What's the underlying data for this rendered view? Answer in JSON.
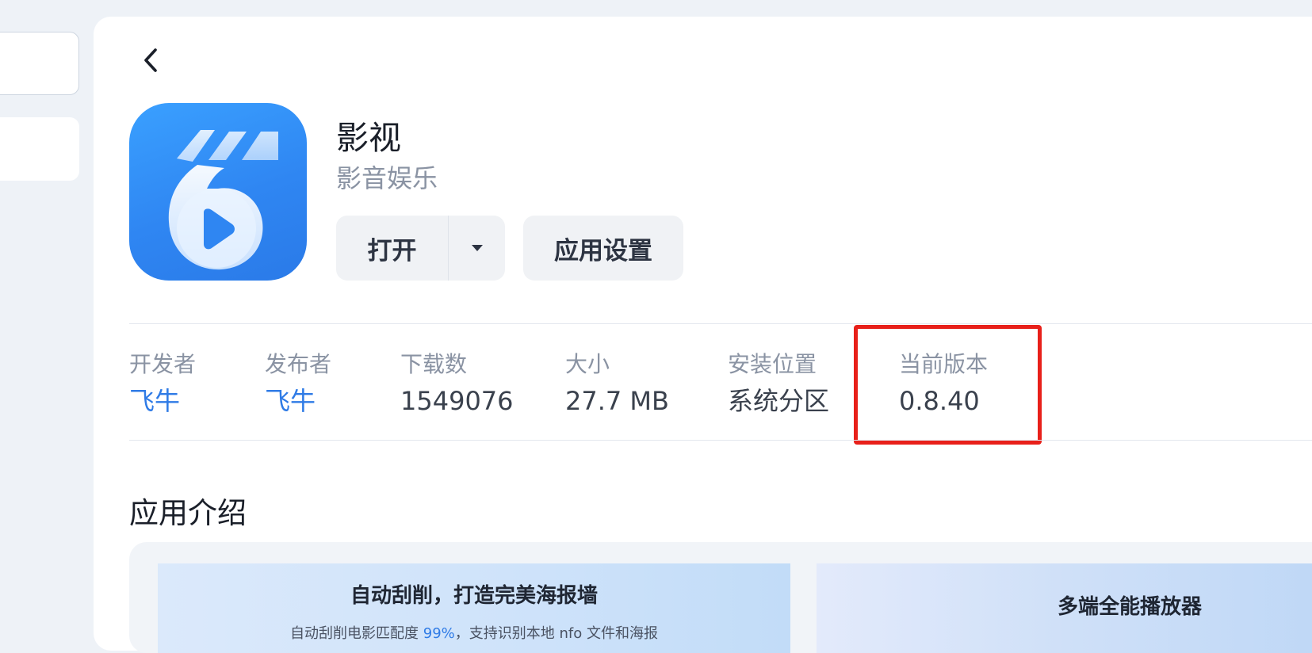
{
  "app": {
    "name": "影视",
    "category": "影音娱乐"
  },
  "actions": {
    "open_label": "打开",
    "settings_label": "应用设置"
  },
  "meta": [
    {
      "label": "开发者",
      "value": "飞牛"
    },
    {
      "label": "发布者",
      "value": "飞牛"
    },
    {
      "label": "下载数",
      "value": "1549076"
    },
    {
      "label": "大小",
      "value": "27.7 MB"
    },
    {
      "label": "安装位置",
      "value": "系统分区"
    },
    {
      "label": "当前版本",
      "value": "0.8.40"
    }
  ],
  "intro": {
    "title": "应用介绍",
    "screenshots": [
      {
        "title": "自动刮削，打造完美海报墙",
        "subtitle_pre": "自动刮削电影匹配度 ",
        "subtitle_accent": "99%",
        "subtitle_post": "，支持识别本地 nfo 文件和海报"
      },
      {
        "title": "多端全能播放器"
      }
    ]
  },
  "colors": {
    "accent": "#2f7be6",
    "highlight": "#e8201a",
    "icon_bg": "#2f86f2"
  },
  "icons": {
    "back": "chevron-left-icon",
    "dropdown": "caret-down-icon",
    "app": "film-play-icon"
  }
}
